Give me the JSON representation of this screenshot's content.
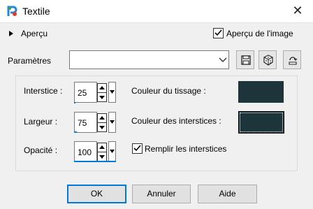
{
  "window": {
    "title": "Textile"
  },
  "preview": {
    "toggle_label": "Aperçu",
    "image_preview_label": "Aperçu de l'image",
    "image_preview_checked": true
  },
  "params": {
    "label": "Paramètres",
    "combo_value": ""
  },
  "fields": {
    "interstice": {
      "label": "Interstice :",
      "value": "25"
    },
    "largeur": {
      "label": "Largeur :",
      "value": "75"
    },
    "opacite": {
      "label": "Opacité :",
      "value": "100"
    },
    "couleur_tissage": {
      "label": "Couleur du tissage :",
      "color": "#1d343b"
    },
    "couleur_interstices": {
      "label": "Couleur des interstices :",
      "color": "#1d343b"
    },
    "remplir": {
      "label": "Remplir les interstices",
      "checked": true
    }
  },
  "buttons": {
    "ok": "OK",
    "cancel": "Annuler",
    "help": "Aide"
  },
  "colors": {
    "accent": "#0078d7"
  }
}
